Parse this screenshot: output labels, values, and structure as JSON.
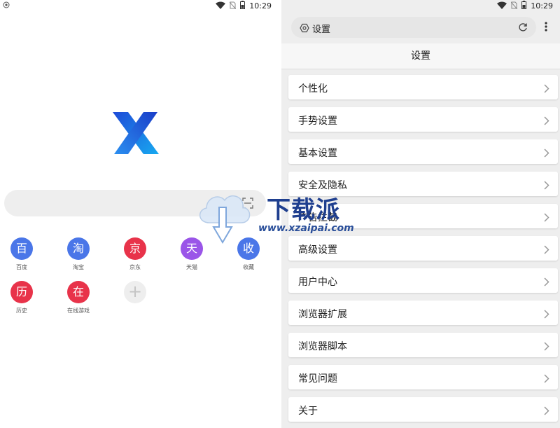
{
  "status_bar": {
    "time": "10:29"
  },
  "left": {
    "quick_links": [
      {
        "glyph": "百",
        "label": "百度",
        "color": "#4a76e8"
      },
      {
        "glyph": "淘",
        "label": "淘宝",
        "color": "#4a76e8"
      },
      {
        "glyph": "京",
        "label": "京东",
        "color": "#e8334a"
      },
      {
        "glyph": "天",
        "label": "天猫",
        "color": "#9a55e8"
      },
      {
        "glyph": "收",
        "label": "收藏",
        "color": "#4a76e8"
      },
      {
        "glyph": "历",
        "label": "历史",
        "color": "#e8334a"
      },
      {
        "glyph": "在",
        "label": "在线游戏",
        "color": "#e8334a"
      }
    ],
    "add_glyph": "+"
  },
  "watermark": {
    "title": "下载派",
    "url": "www.xzaipai.com"
  },
  "right": {
    "url_bar_text": "设置",
    "page_title": "设置",
    "settings": [
      {
        "label": "个性化"
      },
      {
        "label": "手势设置"
      },
      {
        "label": "基本设置"
      },
      {
        "label": "安全及隐私"
      },
      {
        "label": "广告拦截"
      },
      {
        "label": "高级设置"
      },
      {
        "label": "用户中心"
      },
      {
        "label": "浏览器扩展"
      },
      {
        "label": "浏览器脚本"
      },
      {
        "label": "常见问题"
      },
      {
        "label": "关于"
      }
    ]
  },
  "icons": {
    "status": [
      "wifi-icon",
      "no-sim-icon",
      "battery-icon"
    ],
    "logo": "x-browser-logo",
    "scan": "scan-icon",
    "url_settings": "settings-gear-icon",
    "reload": "reload-icon",
    "menu": "more-vert-icon",
    "chevron": "chevron-right-icon"
  },
  "colors": {
    "accent_blue": "#4a76e8",
    "accent_red": "#e8334a",
    "accent_purple": "#9a55e8"
  }
}
